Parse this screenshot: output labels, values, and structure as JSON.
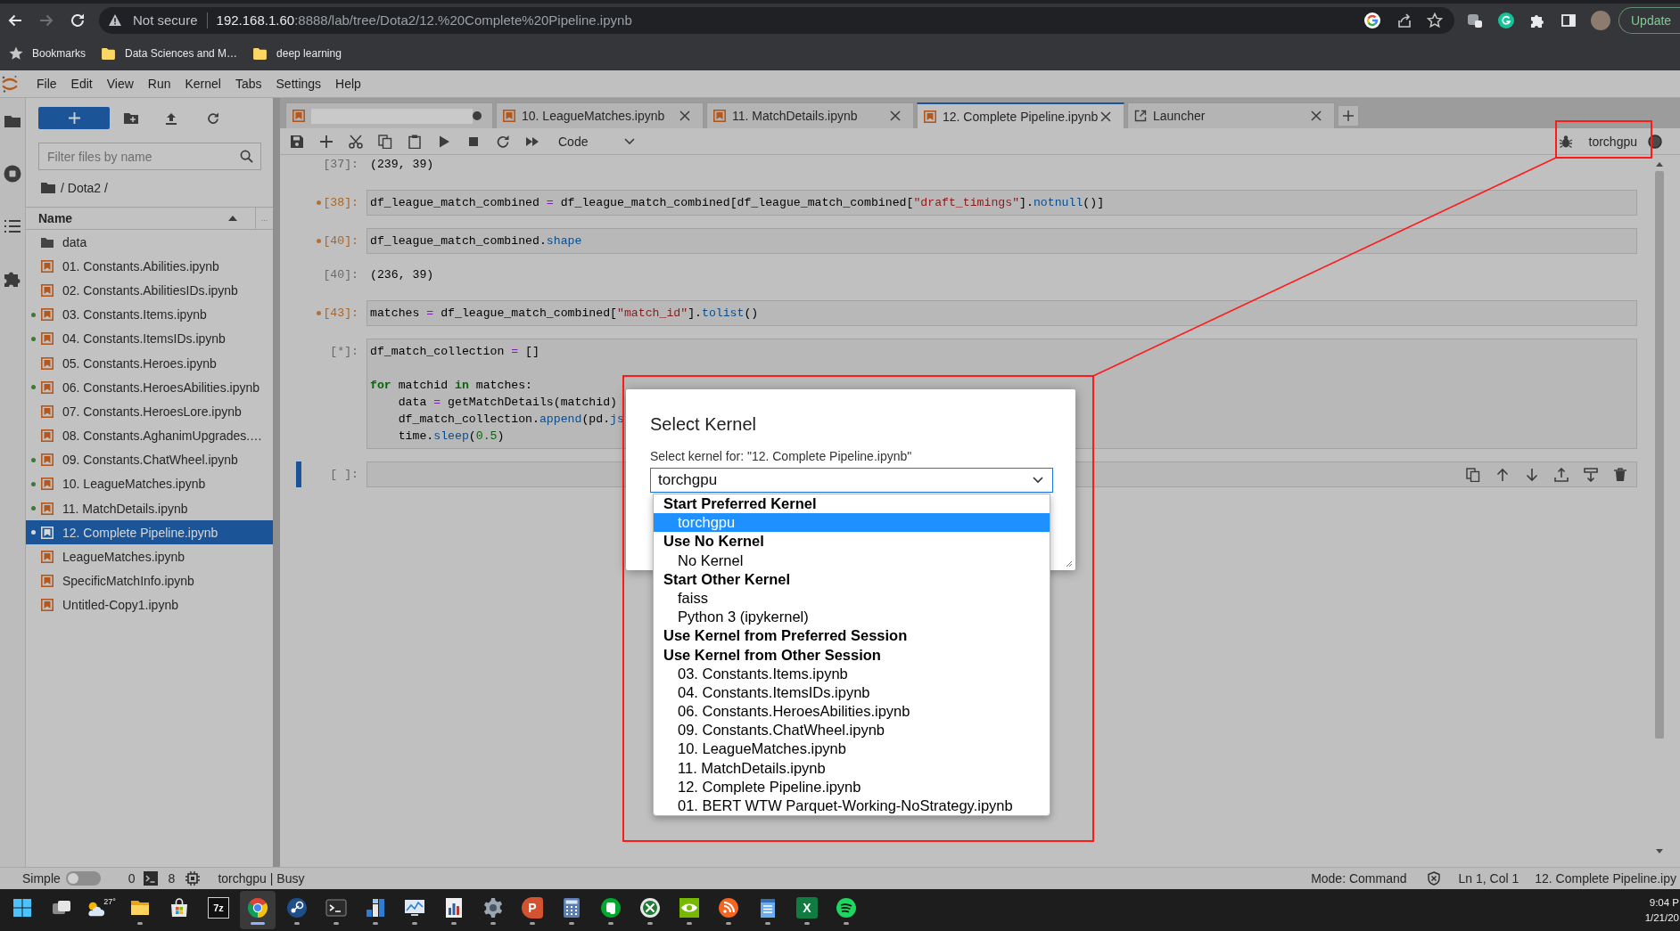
{
  "browser": {
    "forward_disabled": true,
    "security": "Not secure",
    "host": "192.168.1.60",
    "path": ":8888/lab/tree/Dota2/12.%20Complete%20Pipeline.ipynb",
    "update_button": "Update"
  },
  "bookmarks": [
    {
      "kind": "star",
      "label": "Bookmarks"
    },
    {
      "kind": "folder",
      "label": "Data Sciences and M…"
    },
    {
      "kind": "folder",
      "label": "deep learning"
    }
  ],
  "menu": [
    "File",
    "Edit",
    "View",
    "Run",
    "Kernel",
    "Tabs",
    "Settings",
    "Help"
  ],
  "activity_bar": [
    {
      "kind": "files"
    },
    {
      "kind": "running"
    },
    {
      "kind": "toc"
    },
    {
      "kind": "extensions"
    }
  ],
  "file_browser": {
    "filter_placeholder": "Filter files by name",
    "breadcrumb": "/ Dota2 /",
    "columns": [
      "Name",
      "..."
    ],
    "sort_ascending": true,
    "items": [
      {
        "name": "data",
        "kind": "folder",
        "running": false,
        "selected": false
      },
      {
        "name": "01. Constants.Abilities.ipynb",
        "kind": "notebook",
        "running": false,
        "selected": false
      },
      {
        "name": "02. Constants.AbilitiesIDs.ipynb",
        "kind": "notebook",
        "running": false,
        "selected": false
      },
      {
        "name": "03. Constants.Items.ipynb",
        "kind": "notebook",
        "running": true,
        "selected": false
      },
      {
        "name": "04. Constants.ItemsIDs.ipynb",
        "kind": "notebook",
        "running": true,
        "selected": false
      },
      {
        "name": "05. Constants.Heroes.ipynb",
        "kind": "notebook",
        "running": false,
        "selected": false
      },
      {
        "name": "06. Constants.HeroesAbilities.ipynb",
        "kind": "notebook",
        "running": true,
        "selected": false
      },
      {
        "name": "07. Constants.HeroesLore.ipynb",
        "kind": "notebook",
        "running": false,
        "selected": false
      },
      {
        "name": "08. Constants.AghanimUpgrades.…",
        "kind": "notebook",
        "running": false,
        "selected": false
      },
      {
        "name": "09. Constants.ChatWheel.ipynb",
        "kind": "notebook",
        "running": true,
        "selected": false
      },
      {
        "name": "10. LeagueMatches.ipynb",
        "kind": "notebook",
        "running": true,
        "selected": false
      },
      {
        "name": "11. MatchDetails.ipynb",
        "kind": "notebook",
        "running": true,
        "selected": false
      },
      {
        "name": "12. Complete Pipeline.ipynb",
        "kind": "notebook",
        "running": true,
        "selected": true
      },
      {
        "name": "LeagueMatches.ipynb",
        "kind": "notebook",
        "running": false,
        "selected": false
      },
      {
        "name": "SpecificMatchInfo.ipynb",
        "kind": "notebook",
        "running": false,
        "selected": false
      },
      {
        "name": "Untitled-Copy1.ipynb",
        "kind": "notebook",
        "running": false,
        "selected": false
      }
    ]
  },
  "tabs": [
    {
      "kind": "notebook",
      "dirty": true,
      "selected": false
    },
    {
      "kind": "notebook",
      "label": "10. LeagueMatches.ipynb",
      "dirty": false,
      "selected": false
    },
    {
      "kind": "notebook",
      "label": "11. MatchDetails.ipynb",
      "dirty": false,
      "selected": false
    },
    {
      "kind": "notebook",
      "label": "12. Complete Pipeline.ipynb",
      "dirty": false,
      "selected": true
    },
    {
      "kind": "launcher",
      "label": "Launcher",
      "dirty": false,
      "selected": false
    }
  ],
  "toolbar": {
    "cell_type": "Code",
    "kernel_name": "torchgpu",
    "kernel_busy": true
  },
  "cells": [
    {
      "kind": "output",
      "prompt": "[37]:",
      "lines": [
        {
          "kind": "text",
          "tokens": [
            {
              "kind": "plain",
              "text": "(239, 39)"
            }
          ]
        }
      ]
    },
    {
      "kind": "code",
      "prompt": "[38]:",
      "modified": true,
      "active": false,
      "lines": [
        {
          "kind": "text",
          "tokens": [
            {
              "kind": "plain",
              "text": "df_league_match_combined "
            },
            {
              "kind": "op",
              "text": "="
            },
            {
              "kind": "plain",
              "text": " df_league_match_combined[df_league_match_combined["
            },
            {
              "kind": "str",
              "text": "\"draft_timings\""
            },
            {
              "kind": "plain",
              "text": "]."
            },
            {
              "kind": "attr",
              "text": "notnull"
            },
            {
              "kind": "plain",
              "text": "()]"
            }
          ]
        }
      ]
    },
    {
      "kind": "code",
      "prompt": "[40]:",
      "modified": true,
      "active": false,
      "lines": [
        {
          "kind": "text",
          "tokens": [
            {
              "kind": "plain",
              "text": "df_league_match_combined."
            },
            {
              "kind": "attr",
              "text": "shape"
            }
          ]
        }
      ]
    },
    {
      "kind": "output",
      "prompt": "[40]:",
      "lines": [
        {
          "kind": "text",
          "tokens": [
            {
              "kind": "plain",
              "text": "(236, 39)"
            }
          ]
        }
      ]
    },
    {
      "kind": "code",
      "prompt": "[43]:",
      "modified": true,
      "active": false,
      "lines": [
        {
          "kind": "text",
          "tokens": [
            {
              "kind": "plain",
              "text": "matches "
            },
            {
              "kind": "op",
              "text": "="
            },
            {
              "kind": "plain",
              "text": " df_league_match_combined["
            },
            {
              "kind": "str",
              "text": "\"match_id\""
            },
            {
              "kind": "plain",
              "text": "]."
            },
            {
              "kind": "attr",
              "text": "tolist"
            },
            {
              "kind": "plain",
              "text": "()"
            }
          ]
        }
      ]
    },
    {
      "kind": "code",
      "prompt": "[*]:",
      "modified": false,
      "active": false,
      "lines": [
        {
          "kind": "text",
          "tokens": [
            {
              "kind": "plain",
              "text": "df_match_collection "
            },
            {
              "kind": "op",
              "text": "="
            },
            {
              "kind": "plain",
              "text": " []"
            }
          ]
        },
        {
          "kind": "blank"
        },
        {
          "kind": "text",
          "tokens": [
            {
              "kind": "kw",
              "text": "for"
            },
            {
              "kind": "plain",
              "text": " matchid "
            },
            {
              "kind": "kw",
              "text": "in"
            },
            {
              "kind": "plain",
              "text": " matches:"
            }
          ]
        },
        {
          "kind": "text",
          "tokens": [
            {
              "kind": "plain",
              "text": "    data "
            },
            {
              "kind": "op",
              "text": "="
            },
            {
              "kind": "plain",
              "text": " getMatchDetails(matchid)"
            }
          ]
        },
        {
          "kind": "text",
          "tokens": [
            {
              "kind": "plain",
              "text": "    df_match_collection."
            },
            {
              "kind": "attr",
              "text": "append"
            },
            {
              "kind": "plain",
              "text": "(pd."
            },
            {
              "kind": "attr",
              "text": "js"
            }
          ]
        },
        {
          "kind": "text",
          "tokens": [
            {
              "kind": "plain",
              "text": "    time."
            },
            {
              "kind": "attr",
              "text": "sleep"
            },
            {
              "kind": "plain",
              "text": "("
            },
            {
              "kind": "num",
              "text": "0.5"
            },
            {
              "kind": "plain",
              "text": ")"
            }
          ]
        }
      ]
    },
    {
      "kind": "code",
      "prompt": "[ ]:",
      "modified": false,
      "active": true
    }
  ],
  "dialog": {
    "title": "Select Kernel",
    "prompt": "Select kernel for: \"12. Complete Pipeline.ipynb\"",
    "value": "torchgpu",
    "expanded": true,
    "groups": [
      {
        "label": "Start Preferred Kernel",
        "options": [
          {
            "label": "torchgpu",
            "selected": true
          }
        ]
      },
      {
        "label": "Use No Kernel",
        "options": [
          {
            "label": "No Kernel",
            "selected": false
          }
        ]
      },
      {
        "label": "Start Other Kernel",
        "options": [
          {
            "label": "faiss",
            "selected": false
          },
          {
            "label": "Python 3 (ipykernel)",
            "selected": false
          }
        ]
      },
      {
        "label": "Use Kernel from Preferred Session"
      },
      {
        "label": "Use Kernel from Other Session",
        "options": [
          {
            "label": "03. Constants.Items.ipynb",
            "selected": false
          },
          {
            "label": "04. Constants.ItemsIDs.ipynb",
            "selected": false
          },
          {
            "label": "06. Constants.HeroesAbilities.ipynb",
            "selected": false
          },
          {
            "label": "09. Constants.ChatWheel.ipynb",
            "selected": false
          },
          {
            "label": "10. LeagueMatches.ipynb",
            "selected": false
          },
          {
            "label": "11. MatchDetails.ipynb",
            "selected": false
          },
          {
            "label": "12. Complete Pipeline.ipynb",
            "selected": false
          },
          {
            "label": "01. BERT WTW Parquet-Working-NoStrategy.ipynb",
            "selected": false
          }
        ]
      }
    ]
  },
  "status_bar": {
    "simple_label": "Simple",
    "simple_mode": false,
    "terminals": "0",
    "kernels": "8",
    "kernel_status": "torchgpu | Busy",
    "mode": "Mode: Command",
    "position": "Ln 1, Col 1",
    "file": "12. Complete Pipeline.ipy"
  },
  "taskbar": {
    "apps": [
      {
        "kind": "start",
        "running": false,
        "active": false
      },
      {
        "kind": "taskview",
        "running": false,
        "active": false
      },
      {
        "kind": "weather",
        "label": "27°",
        "running": false,
        "active": false
      },
      {
        "kind": "folder",
        "running": true,
        "active": false
      },
      {
        "kind": "store",
        "running": false,
        "active": false
      },
      {
        "kind": "archive",
        "label": "7z",
        "running": false,
        "active": false
      },
      {
        "kind": "browser",
        "running": true,
        "active": true
      },
      {
        "kind": "steam",
        "running": true,
        "active": false
      },
      {
        "kind": "terminal",
        "running": true,
        "active": false
      },
      {
        "kind": "blocks",
        "running": true,
        "active": false
      },
      {
        "kind": "monitor",
        "running": true,
        "active": false
      },
      {
        "kind": "document",
        "running": true,
        "active": false
      },
      {
        "kind": "gear",
        "running": true,
        "active": false
      },
      {
        "kind": "slides",
        "label": "P",
        "running": true,
        "active": false
      },
      {
        "kind": "calculator",
        "running": true,
        "active": false
      },
      {
        "kind": "note",
        "running": true,
        "active": false
      },
      {
        "kind": "cross",
        "running": true,
        "active": false
      },
      {
        "kind": "eye",
        "running": true,
        "active": false
      },
      {
        "kind": "rss",
        "running": true,
        "active": false
      },
      {
        "kind": "notepad",
        "running": true,
        "active": false
      },
      {
        "kind": "sheet",
        "label": "X",
        "running": true,
        "active": false
      },
      {
        "kind": "music",
        "running": true,
        "active": false
      }
    ],
    "time": "9:04 P",
    "date": "1/21/20"
  }
}
